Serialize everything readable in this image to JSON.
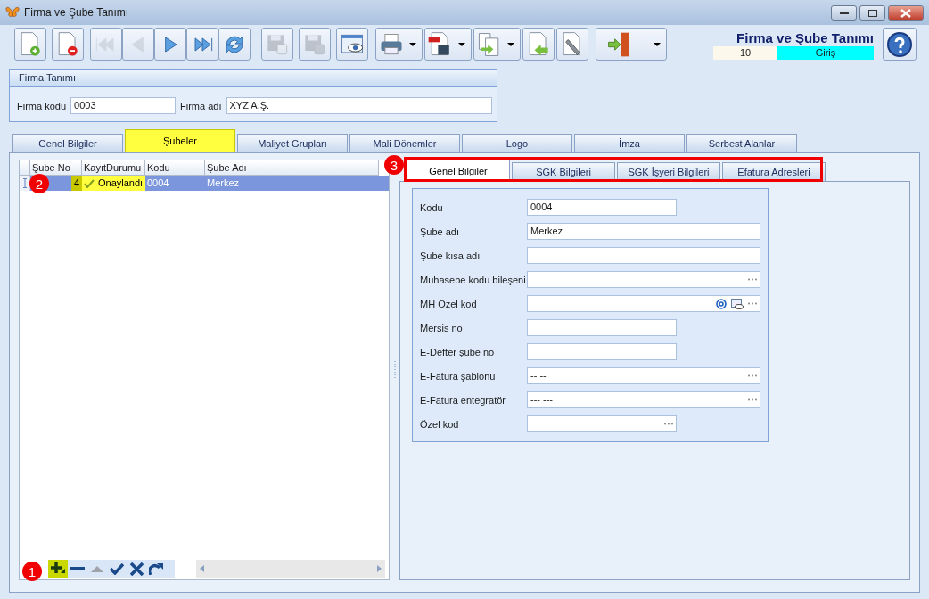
{
  "window": {
    "title": "Firma ve Şube Tanımı"
  },
  "toolbar": [
    {
      "kind": "new",
      "disabled": false
    },
    {
      "kind": "delete",
      "disabled": false
    },
    {
      "kind": "first",
      "disabled": true
    },
    {
      "kind": "prev",
      "disabled": true
    },
    {
      "kind": "next",
      "disabled": false
    },
    {
      "kind": "last",
      "disabled": false
    },
    {
      "kind": "refresh",
      "disabled": false
    },
    {
      "kind": "save",
      "disabled": true
    },
    {
      "kind": "saveclose",
      "disabled": true
    },
    {
      "kind": "preview",
      "disabled": false
    },
    {
      "kind": "print",
      "disabled": false,
      "dropdown": true
    },
    {
      "kind": "pdf",
      "disabled": false,
      "dropdown": true
    },
    {
      "kind": "copy",
      "disabled": false,
      "dropdown": true
    },
    {
      "kind": "import",
      "disabled": false
    },
    {
      "kind": "tools",
      "disabled": false
    },
    {
      "kind": "exit",
      "disabled": false,
      "dropdown": true
    }
  ],
  "header": {
    "title": "Firma ve Şube Tanımı",
    "number": "10",
    "mode": "Giriş"
  },
  "firma": {
    "title": "Firma Tanımı",
    "fields": [
      {
        "label": "Firma kodu",
        "value": "0003",
        "kind": "short"
      },
      {
        "label": "Firma adı",
        "value": "XYZ A.Ş.",
        "kind": "long"
      }
    ]
  },
  "tabs": [
    {
      "label": "Genel Bilgiler",
      "selected": false,
      "highlighted": false
    },
    {
      "label": "Şubeler",
      "selected": true,
      "highlighted": true
    },
    {
      "label": "Maliyet Grupları",
      "selected": false,
      "highlighted": false
    },
    {
      "label": "Mali Dönemler",
      "selected": false,
      "highlighted": false
    },
    {
      "label": "Logo",
      "selected": false,
      "highlighted": false
    },
    {
      "label": "İmza",
      "selected": false,
      "highlighted": false
    },
    {
      "label": "Serbest Alanlar",
      "selected": false,
      "highlighted": false
    }
  ],
  "grid": {
    "columns": [
      "Şube No",
      "KayıtDurumu",
      "Kodu",
      "Şube Adı"
    ],
    "rows": [
      {
        "selected": true,
        "cells": [
          {
            "text": "4",
            "highlighted": true
          },
          {
            "text": "Onaylandı",
            "highlighted": true,
            "check": true
          },
          {
            "text": "0004",
            "highlighted": false
          },
          {
            "text": "Merkez",
            "highlighted": false
          }
        ]
      }
    ],
    "navigator": [
      {
        "kind": "add",
        "disabled": false,
        "highlighted": true
      },
      {
        "kind": "remove",
        "disabled": false,
        "highlighted": false
      },
      {
        "kind": "up",
        "disabled": true,
        "highlighted": false
      },
      {
        "kind": "post",
        "disabled": false,
        "highlighted": false
      },
      {
        "kind": "cancel",
        "disabled": false,
        "highlighted": false
      },
      {
        "kind": "redo",
        "disabled": false,
        "highlighted": false
      }
    ]
  },
  "sub_tabs": [
    {
      "label": "Genel Bilgiler",
      "selected": true
    },
    {
      "label": "SGK Bilgileri",
      "selected": false
    },
    {
      "label": "SGK İşyeri Bilgileri",
      "selected": false
    },
    {
      "label": "Efatura Adresleri",
      "selected": false
    }
  ],
  "form": [
    {
      "label": "Kodu",
      "value": "0004",
      "kind": "short",
      "lookup": false
    },
    {
      "label": "Şube adı",
      "value": "Merkez",
      "kind": "long",
      "lookup": false
    },
    {
      "label": "Şube kısa adı",
      "kind": "long",
      "lookup": false
    },
    {
      "label": "Muhasebe kodu bileşeni",
      "kind": "long",
      "lookup": true
    },
    {
      "label": "MH Özel kod",
      "kind": "long",
      "lookup": true,
      "email": true,
      "viewer": true
    },
    {
      "label": "Mersis no",
      "kind": "short",
      "lookup": false
    },
    {
      "label": "E-Defter şube no",
      "kind": "short",
      "lookup": false
    },
    {
      "label": "E-Fatura şablonu",
      "value": "-- --",
      "kind": "long",
      "lookup": true
    },
    {
      "label": "E-Fatura entegratör",
      "value": "--- ---",
      "kind": "long",
      "lookup": true
    },
    {
      "label": "Özel kod",
      "kind": "short",
      "lookup": true
    }
  ],
  "annotations": [
    {
      "label": "1",
      "kind": "filled"
    },
    {
      "label": "2",
      "kind": "filled"
    },
    {
      "label": "3",
      "kind": "filled"
    }
  ]
}
